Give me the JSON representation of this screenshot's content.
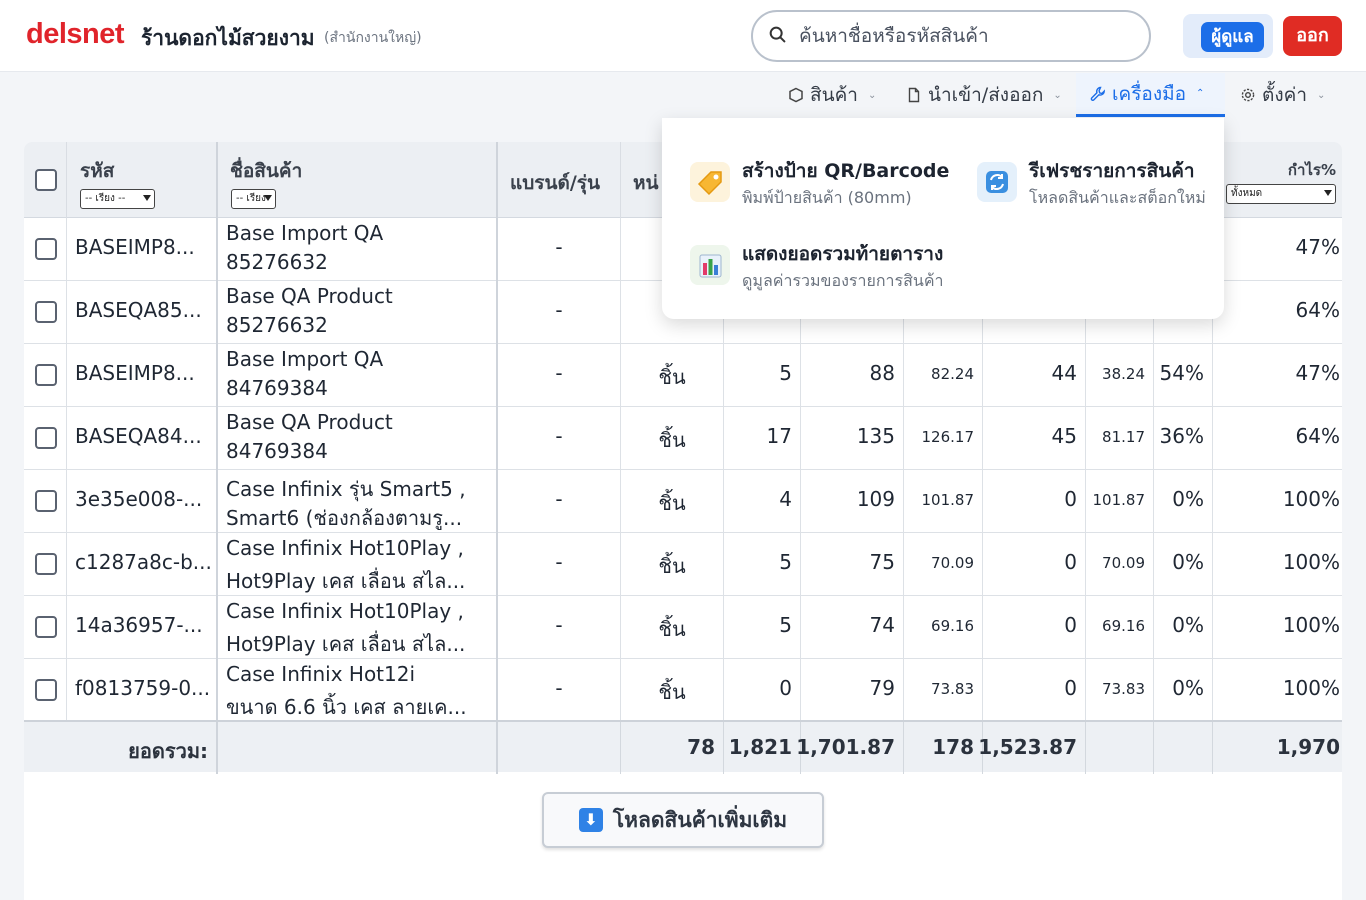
{
  "header": {
    "logo": "delsnet",
    "shop_name": "ร้านดอกไม้สวยงาม",
    "shop_branch": "(สำนักงานใหญ่)",
    "search_placeholder": "ค้นหาชื่อหรือรหัสสินค้า",
    "admin_label": "ผู้ดูแล",
    "logout_label": "ออก"
  },
  "nav": {
    "products": "สินค้า",
    "import_export": "นำเข้า/ส่งออก",
    "tools": "เครื่องมือ",
    "settings": "ตั้งค่า"
  },
  "tools_menu": {
    "items": [
      {
        "title": "สร้างป้าย QR/Barcode",
        "subtitle": "พิมพ์ป้ายสินค้า (80mm)",
        "icon": "tag-icon"
      },
      {
        "title": "รีเฟรชรายการสินค้า",
        "subtitle": "โหลดสินค้าและสต็อกใหม่",
        "icon": "refresh-icon"
      },
      {
        "title": "แสดงยอดรวมท้ายตาราง",
        "subtitle": "ดูมูลค่ารวมของรายการสินค้า",
        "icon": "bar-chart-icon"
      }
    ]
  },
  "table": {
    "headers": {
      "code": "รหัส",
      "name": "ชื่อสินค้า",
      "brand": "แบรนด์/รุ่น",
      "unit": "หน่",
      "profit_pct": "กำไร%"
    },
    "sort_placeholder": "-- เรียง --",
    "sort_placeholder_short": "-- เรียง",
    "profit_filter": "ทั้งหมด",
    "rows": [
      {
        "code": "BASEIMP8...",
        "name1": "Base Import QA",
        "name2": "85276632",
        "brand": "-",
        "unit": "",
        "c1": "",
        "c2": "",
        "c3": "",
        "c4": "",
        "c5": "",
        "c6": "",
        "profit": "47%"
      },
      {
        "code": "BASEQA85...",
        "name1": "Base QA Product",
        "name2": "85276632",
        "brand": "-",
        "unit": "",
        "c1": "",
        "c2": "",
        "c3": "",
        "c4": "",
        "c5": "",
        "c6": "",
        "profit": "64%"
      },
      {
        "code": "BASEIMP8...",
        "name1": "Base Import QA",
        "name2": "84769384",
        "brand": "-",
        "unit": "ชิ้น",
        "c1": "5",
        "c2": "88",
        "c3": "82.24",
        "c4": "44",
        "c5": "38.24",
        "c6": "54%",
        "profit": "47%"
      },
      {
        "code": "BASEQA84...",
        "name1": "Base QA Product",
        "name2": "84769384",
        "brand": "-",
        "unit": "ชิ้น",
        "c1": "17",
        "c2": "135",
        "c3": "126.17",
        "c4": "45",
        "c5": "81.17",
        "c6": "36%",
        "profit": "64%"
      },
      {
        "code": "3e35e008-...",
        "name1": "Case Infinix รุ่น Smart5 ,",
        "name2": "Smart6 (ช่องกล้องตามรู...",
        "brand": "-",
        "unit": "ชิ้น",
        "c1": "4",
        "c2": "109",
        "c3": "101.87",
        "c4": "0",
        "c5": "101.87",
        "c6": "0%",
        "profit": "100%"
      },
      {
        "code": "c1287a8c-b...",
        "name1": "Case Infinix Hot10Play ,",
        "name2": "Hot9Play เคส เลื่อน สไล...",
        "brand": "-",
        "unit": "ชิ้น",
        "c1": "5",
        "c2": "75",
        "c3": "70.09",
        "c4": "0",
        "c5": "70.09",
        "c6": "0%",
        "profit": "100%"
      },
      {
        "code": "14a36957-...",
        "name1": "Case Infinix Hot10Play ,",
        "name2": "Hot9Play เคส เลื่อน สไล...",
        "brand": "-",
        "unit": "ชิ้น",
        "c1": "5",
        "c2": "74",
        "c3": "69.16",
        "c4": "0",
        "c5": "69.16",
        "c6": "0%",
        "profit": "100%"
      },
      {
        "code": "f0813759-0...",
        "name1": "Case Infinix Hot12i",
        "name2": "ขนาด 6.6 นิ้ว เคส ลายเค...",
        "brand": "-",
        "unit": "ชิ้น",
        "c1": "0",
        "c2": "79",
        "c3": "73.83",
        "c4": "0",
        "c5": "73.83",
        "c6": "0%",
        "profit": "100%"
      }
    ],
    "footer": {
      "label": "ยอดรวม:",
      "c1": "78",
      "c2": "1,821",
      "c3": "1,701.87",
      "c4": "178",
      "c5": "1,523.87",
      "profit": "1,970"
    }
  },
  "load_more_label": "โหลดสินค้าเพิ่มเติม",
  "colors": {
    "brand_red": "#e0242b",
    "primary_blue": "#1c6ee8",
    "logout_red": "#e02c24"
  }
}
